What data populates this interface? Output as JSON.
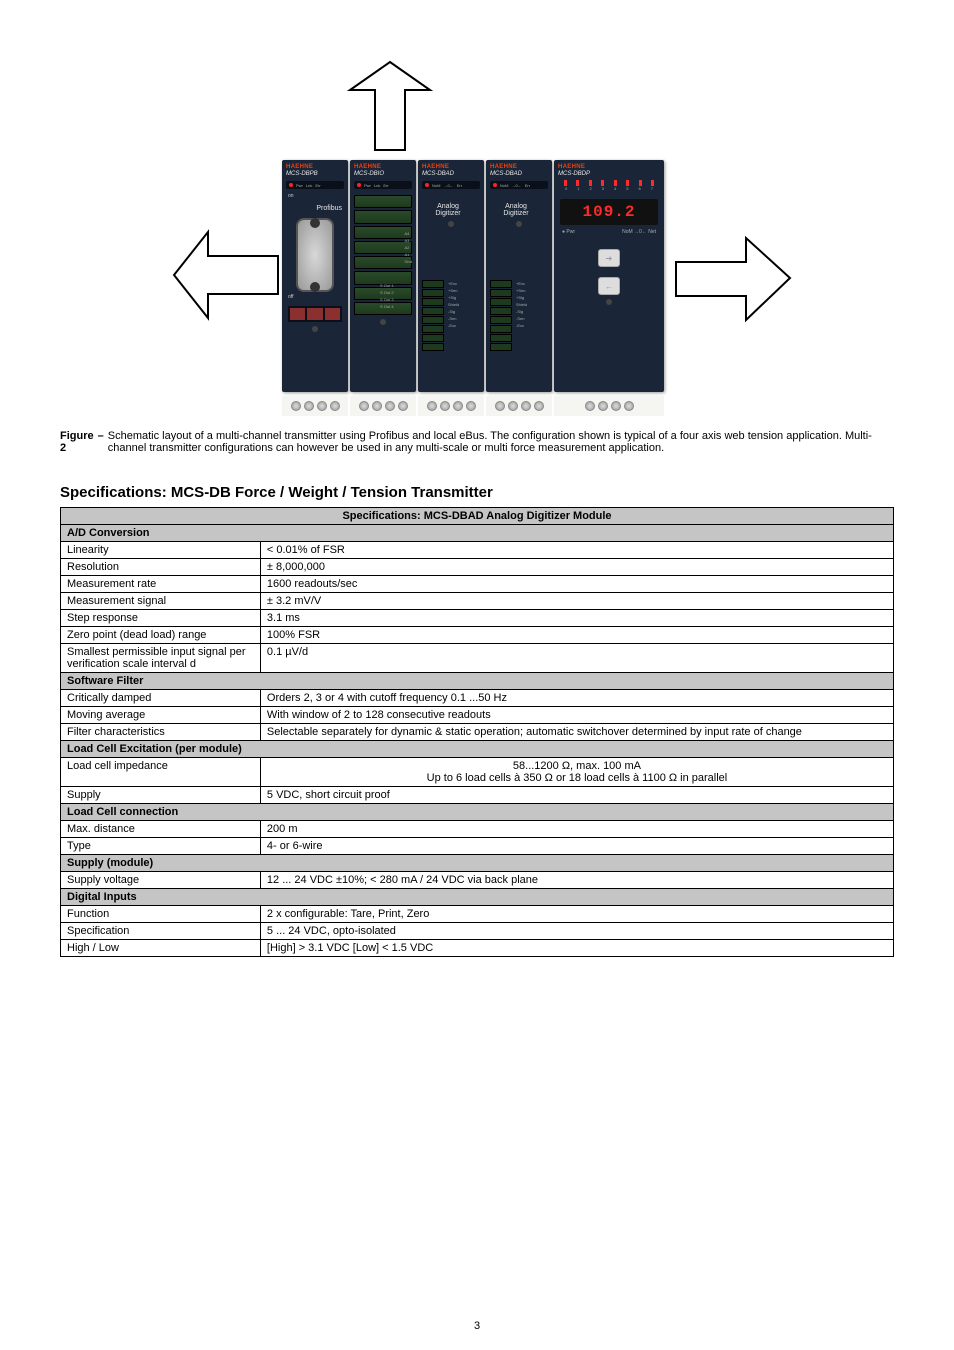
{
  "figure": {
    "label": "Figure 2",
    "dash": "–",
    "caption": "Schematic layout of a multi-channel transmitter using Profibus and local eBus. The configuration shown is typical of a four axis web tension application. Multi-channel transmitter configurations can however be used in any multi-scale or multi force measurement application.",
    "modules": {
      "m1": {
        "brand": "HAEHNE",
        "model": "MCS-DBPB",
        "body": "Profibus",
        "on": "on",
        "off": "off"
      },
      "m2": {
        "brand": "HAEHNE",
        "model": "MCS-DBIO",
        "io": "I/O"
      },
      "m3": {
        "brand": "HAEHNE",
        "model": "MCS-DBAD",
        "body1": "Analog",
        "body2": "Digitizer"
      },
      "m4": {
        "brand": "HAEHNE",
        "model": "MCS-DBAD",
        "body1": "Analog",
        "body2": "Digitizer"
      },
      "m5": {
        "brand": "HAEHNE",
        "model": "MCS-DBDP",
        "value": "109.2"
      }
    }
  },
  "section_title": "Specifications: MCS-DB Force / Weight / Tension Transmitter",
  "table": {
    "header": "Specifications: MCS-DBAD Analog Digitizer Module",
    "sub_ad": "A/D Conversion",
    "rows_ad": [
      [
        "Linearity",
        "< 0.01% of FSR"
      ],
      [
        "Resolution",
        "± 8,000,000"
      ],
      [
        "Measurement rate",
        "1600 readouts/sec"
      ],
      [
        "Measurement signal",
        "± 3.2 mV/V"
      ],
      [
        "Step response",
        "3.1 ms"
      ],
      [
        "Zero point (dead load) range",
        "100% FSR"
      ],
      [
        "Smallest permissible input signal per verification scale interval d",
        "0.1 µV/d"
      ]
    ],
    "sub_filter": "Software Filter",
    "rows_filter": [
      [
        "Critically damped",
        "Orders 2, 3 or 4 with cutoff frequency 0.1 ...50 Hz"
      ],
      [
        "Moving average",
        "With window of 2 to 128 consecutive readouts"
      ],
      [
        "Filter characteristics",
        "Selectable separately for dynamic & static operation; automatic switchover determined by input rate of change"
      ]
    ],
    "sub_exc": "Load Cell Excitation (per module)",
    "rows_exc": [
      [
        "Load cell impedance",
        "58...1200 Ω,  max. 100 mA\nUp to 6 load cells à 350 Ω or 18 load cells à 1100 Ω in parallel"
      ],
      [
        "Supply",
        "5 VDC, short circuit proof"
      ]
    ],
    "sub_conn": "Load Cell connection",
    "rows_conn": [
      [
        "Max. distance",
        "200 m"
      ],
      [
        "Type",
        "4- or 6-wire"
      ]
    ],
    "sub_supply": "Supply (module)",
    "rows_supply": [
      [
        "Supply voltage",
        "12 ... 24 VDC ±10%; < 280 mA / 24 VDC via back plane"
      ]
    ],
    "sub_di": "Digital Inputs",
    "rows_di": [
      [
        "Function",
        "2 x configurable: Tare, Print, Zero"
      ],
      [
        "Specification",
        "5 ... 24 VDC, opto-isolated"
      ],
      [
        "High / Low",
        "[High] > 3.1 VDC     [Low] < 1.5 VDC"
      ]
    ]
  },
  "pageNumber": "3"
}
